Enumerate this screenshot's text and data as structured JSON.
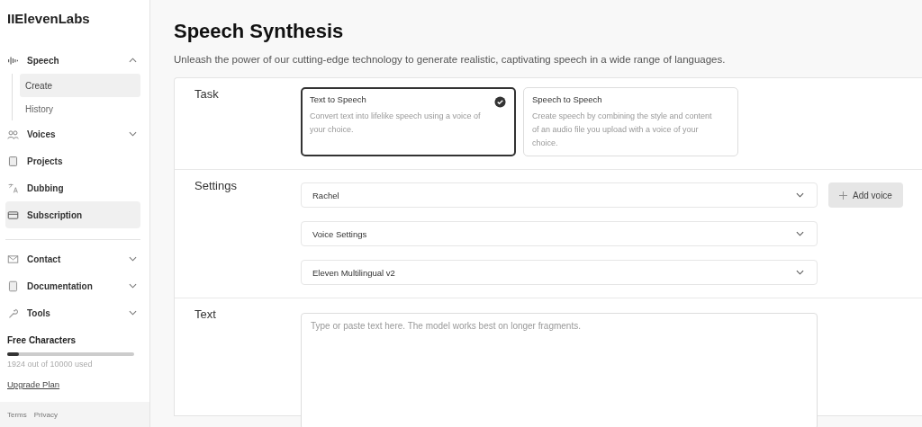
{
  "logo": "IIElevenLabs",
  "nav": [
    {
      "label": "Speech",
      "expanded": true,
      "highlighted": false,
      "children": [
        {
          "label": "Create",
          "selected": true
        },
        {
          "label": "History",
          "selected": false
        }
      ]
    },
    {
      "label": "Voices",
      "expanded": false,
      "highlighted": false
    },
    {
      "label": "Projects",
      "highlighted": false
    },
    {
      "label": "Dubbing",
      "highlighted": false
    },
    {
      "label": "Subscription",
      "highlighted": true
    }
  ],
  "nav_secondary": [
    {
      "label": "Contact",
      "expanded": false
    },
    {
      "label": "Documentation",
      "expanded": false
    },
    {
      "label": "Tools",
      "expanded": false
    }
  ],
  "usage": {
    "title": "Free Characters",
    "level": 0.09,
    "reading": "1924 out of 10000 used",
    "link": "Upgrade Plan"
  },
  "footer_links": [
    "Terms",
    "Privacy"
  ],
  "title": "Speech Synthesis",
  "subtitle": "Unleash the power of our cutting-edge technology to generate realistic, captivating speech in a wide range of languages.",
  "task": {
    "label": "Task",
    "options": [
      {
        "title": "Text to Speech",
        "description": "Convert text into lifelike speech using a voice of your choice.",
        "selected": true
      },
      {
        "title": "Speech to Speech",
        "description": "Create speech by combining the style and content of an audio file you upload with a voice of your choice.",
        "selected": false
      }
    ]
  },
  "settings": {
    "label": "Settings",
    "dropdowns": [
      "Rachel",
      "Voice Settings",
      "Eleven Multilingual v2"
    ],
    "add_button": "Add voice"
  },
  "text": {
    "label": "Text",
    "placeholder": "Type or paste text here. The model works best on longer fragments."
  }
}
